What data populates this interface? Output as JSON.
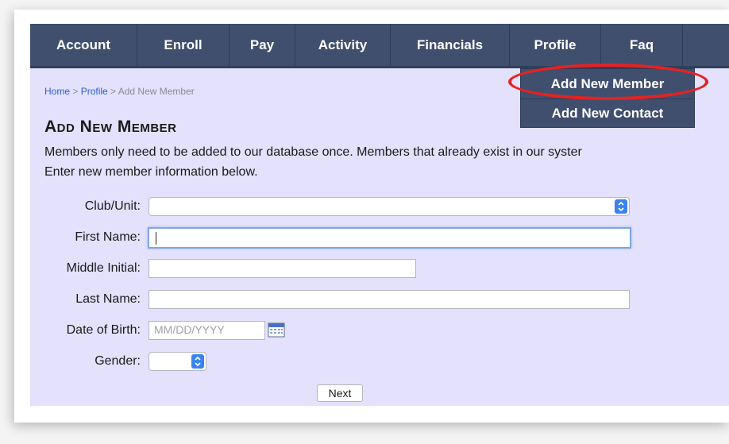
{
  "nav": {
    "items": [
      {
        "label": "Account"
      },
      {
        "label": "Enroll"
      },
      {
        "label": "Pay"
      },
      {
        "label": "Activity"
      },
      {
        "label": "Financials"
      },
      {
        "label": "Profile"
      },
      {
        "label": "Faq"
      }
    ]
  },
  "dropdown": {
    "items": [
      {
        "label": "Add New Member"
      },
      {
        "label": "Add New Contact"
      }
    ]
  },
  "breadcrumb": {
    "home": "Home",
    "sep1": " > ",
    "profile": "Profile",
    "sep2": " > ",
    "current": "Add New Member"
  },
  "page": {
    "title": "Add New Member",
    "intro_line1": "Members only need to be added to our database once. Members that already exist in our syster",
    "intro_line2": "Enter new member information below."
  },
  "form": {
    "club_label": "Club/Unit:",
    "club_value": "",
    "first_name_label": "First Name:",
    "first_name_value": "",
    "middle_initial_label": "Middle Initial:",
    "middle_initial_value": "",
    "last_name_label": "Last Name:",
    "last_name_value": "",
    "dob_label": "Date of Birth:",
    "dob_placeholder": "MM/DD/YYYY",
    "gender_label": "Gender:",
    "gender_value": "",
    "next_label": "Next"
  },
  "colors": {
    "nav_bg": "#404f6e",
    "page_bg": "#e3e1fb",
    "highlight": "#e52222",
    "link": "#2a5fd6"
  }
}
